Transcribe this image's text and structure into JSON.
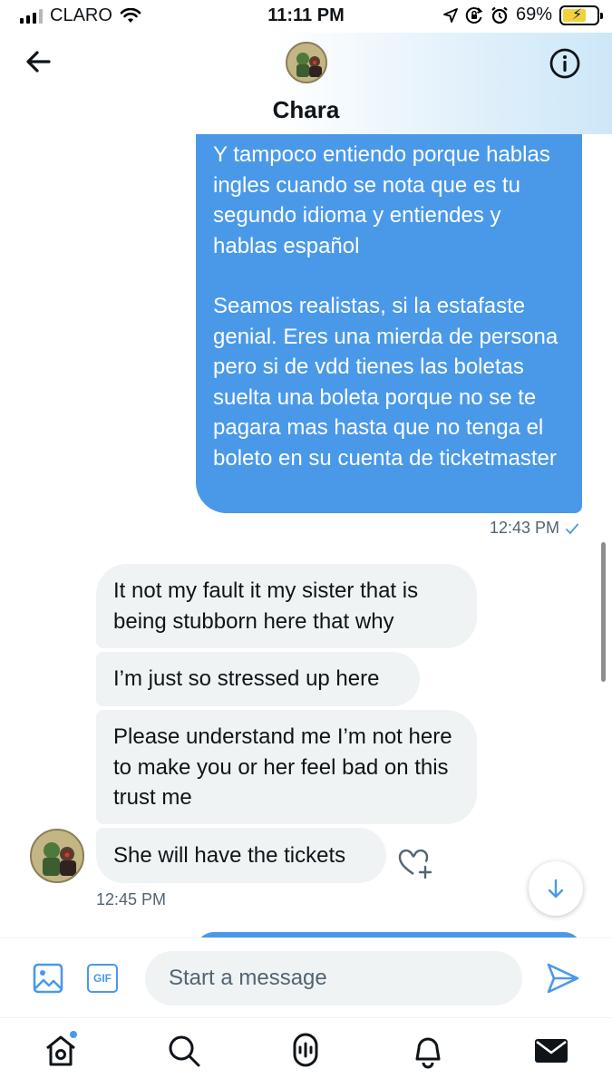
{
  "status_bar": {
    "carrier": "CLARO",
    "time": "11:11 PM",
    "battery": "69%",
    "battery_level": 0.69,
    "battery_color": "#f1d23c"
  },
  "header": {
    "title": "Chara",
    "back_icon": "arrow-left-icon",
    "info_icon": "info-circle-icon"
  },
  "messages": {
    "sent": {
      "paragraphs": [
        "Y tampoco entiendo porque hablas ingles cuando se nota que es tu segundo idioma y entiendes y hablas español",
        "Seamos realistas, si la estafaste genial. Eres una mierda de persona pero si de vdd tienes las boletas suelta una boleta porque no se te pagara mas hasta que no tenga el boleto en su cuenta de ticketmaster"
      ],
      "time": "12:43 PM",
      "status_icon": "check-icon"
    },
    "received": [
      "It not my fault it my sister that is being stubborn here that why",
      "I’m just so stressed up here",
      "Please understand me I’m not here to make you or her feel bad on this trust me",
      "She will have the tickets"
    ],
    "received_time": "12:45 PM"
  },
  "composer": {
    "placeholder": "Start a message",
    "gif_label": "GIF"
  },
  "colors": {
    "accent": "#4a99e9",
    "sent_bubble": "#4a99e9",
    "received_bubble": "#eff3f4",
    "meta_text": "#536471"
  },
  "bottom_nav": [
    "home-icon",
    "search-icon",
    "spaces-icon",
    "notifications-icon",
    "messages-icon"
  ]
}
